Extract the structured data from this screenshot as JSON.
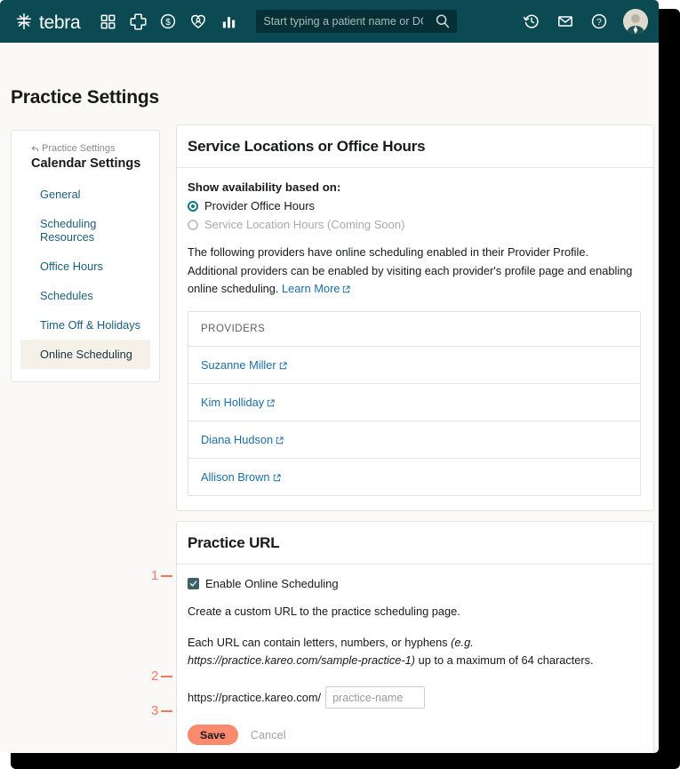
{
  "colors": {
    "nav_background": "#0b4a53",
    "page_background": "#faf9f7",
    "accent_salmon": "#fa8a6e",
    "marker_salmon": "#f4775c",
    "link_blue": "#1a6ea8",
    "sidebar_link": "#1a5f7a",
    "radio_teal": "#12767f",
    "checkbox_slate": "#3c6168",
    "active_item_background": "#f5f1e9"
  },
  "topnav": {
    "logo_text": "tebra",
    "logo_icon": "tebra-leaf-logo-icon",
    "nav_icons": [
      {
        "name": "dashboard-grid-icon",
        "label": "Dashboard"
      },
      {
        "name": "medical-cross-icon",
        "label": "Clinical"
      },
      {
        "name": "dollar-circle-icon",
        "label": "Billing"
      },
      {
        "name": "patients-heart-icon",
        "label": "Patients"
      },
      {
        "name": "bar-chart-icon",
        "label": "Reports"
      }
    ],
    "search": {
      "placeholder": "Start typing a patient name or DOB",
      "value": "",
      "icon": "search-icon"
    },
    "right_icons": [
      {
        "name": "history-clock-icon",
        "label": "Recent"
      },
      {
        "name": "envelope-icon",
        "label": "Messages"
      },
      {
        "name": "help-circle-icon",
        "label": "Help"
      }
    ],
    "avatar": {
      "name": "user-avatar",
      "label": "Account"
    }
  },
  "page": {
    "title": "Practice Settings"
  },
  "sidebar": {
    "breadcrumb": {
      "icon": "back-arrow-icon",
      "label": "Practice Settings"
    },
    "heading": "Calendar Settings",
    "items": [
      {
        "label": "General",
        "active": false
      },
      {
        "label": "Scheduling Resources",
        "active": false
      },
      {
        "label": "Office Hours",
        "active": false
      },
      {
        "label": "Schedules",
        "active": false
      },
      {
        "label": "Time Off & Holidays",
        "active": false
      },
      {
        "label": "Online Scheduling",
        "active": true
      }
    ]
  },
  "service_card": {
    "title": "Service Locations or Office Hours",
    "availability_label": "Show availability based on:",
    "radios": [
      {
        "label": "Provider Office Hours",
        "selected": true,
        "disabled": false
      },
      {
        "label": "Service Location Hours (Coming Soon)",
        "selected": false,
        "disabled": true
      }
    ],
    "description": "The following providers have online scheduling enabled in their Provider Profile. Additional providers can be enabled by visiting each provider's profile page and enabling online scheduling.",
    "learn_more_label": "Learn More",
    "providers_header": "PROVIDERS",
    "providers": [
      {
        "name": "Suzanne Miller"
      },
      {
        "name": "Kim Holliday"
      },
      {
        "name": "Diana Hudson"
      },
      {
        "name": "Allison Brown"
      }
    ]
  },
  "url_card": {
    "title": "Practice URL",
    "enable_checkbox": {
      "label": "Enable Online Scheduling",
      "checked": true
    },
    "line1": "Create a custom URL to the practice scheduling page.",
    "line2_prefix": "Each URL can contain letters, numbers, or hyphens ",
    "line2_italic": "(e.g. https://practice.kareo.com/sample-practice-1)",
    "line2_suffix": " up to a maximum of 64 characters.",
    "url_prefix": "https://practice.kareo.com/",
    "url_input": {
      "value": "",
      "placeholder": "practice-name"
    },
    "save_label": "Save",
    "cancel_label": "Cancel"
  },
  "markers": [
    {
      "number": "1"
    },
    {
      "number": "2"
    },
    {
      "number": "3"
    }
  ]
}
